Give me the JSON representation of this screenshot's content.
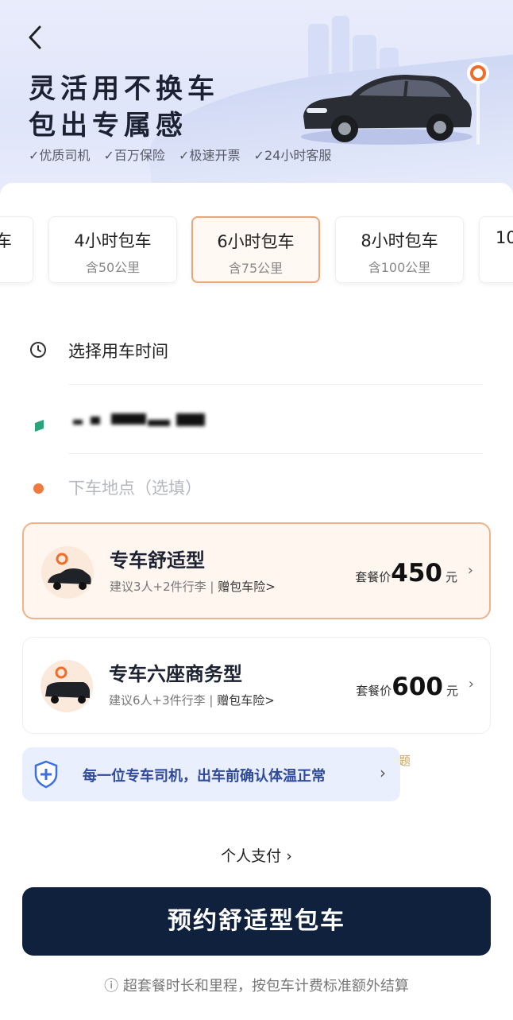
{
  "header": {
    "title_line1": "灵活用不换车",
    "title_line2": "包出专属感",
    "tags": [
      "✓优质司机",
      "✓百万保险",
      "✓极速开票",
      "✓24小时客服"
    ]
  },
  "packages": [
    {
      "name": "车",
      "sub": ""
    },
    {
      "name": "4小时包车",
      "sub": "含50公里"
    },
    {
      "name": "6小时包车",
      "sub": "含75公里",
      "selected": true
    },
    {
      "name": "8小时包车",
      "sub": "含100公里"
    },
    {
      "name": "10",
      "sub": ""
    }
  ],
  "form": {
    "time_label": "选择用车时间",
    "dropoff_placeholder": "下车地点（选填）"
  },
  "cars": [
    {
      "name": "专车舒适型",
      "suggest": "建议3人+2件行李",
      "insurance": "赠包车险>",
      "price_label": "套餐价",
      "price": "450",
      "unit": "元",
      "selected": true
    },
    {
      "name": "专车六座商务型",
      "suggest": "建议6人+3件行李",
      "insurance": "赠包车险>",
      "price_label": "套餐价",
      "price": "600",
      "unit": "元"
    }
  ],
  "notice": {
    "text": "每一位专车司机，出车前确认体温正常",
    "arrow": "›",
    "tail": "题"
  },
  "payment": {
    "label": "个人支付",
    "arrow": "›"
  },
  "book_button": "预约舒适型包车",
  "footer_note": "ⓘ 超套餐时长和里程，按包车计费标准额外结算",
  "colors": {
    "accent": "#e8a77b",
    "button": "#0f213d",
    "notice_bg": "#e9effd"
  }
}
